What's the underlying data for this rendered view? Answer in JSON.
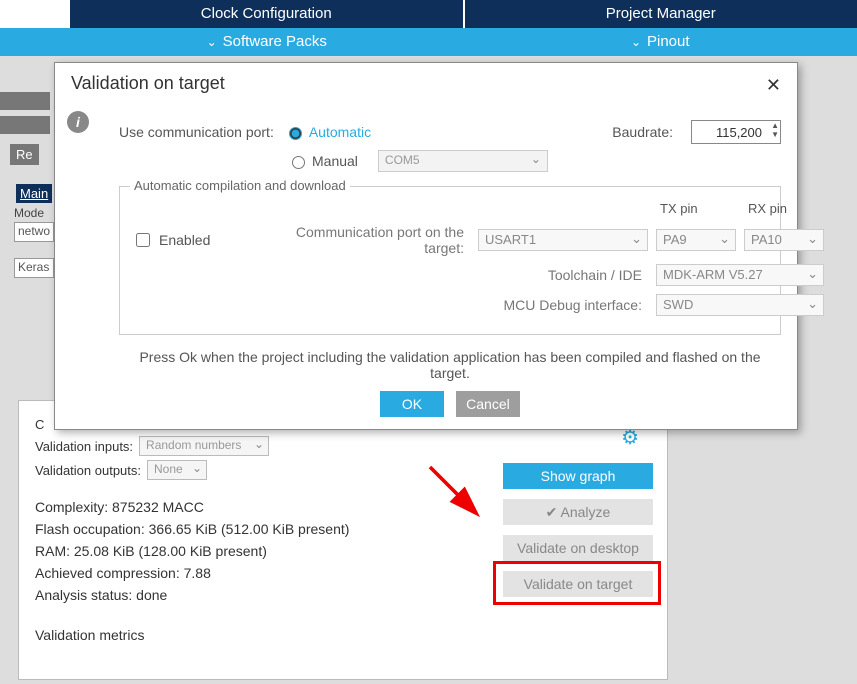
{
  "topTabs": {
    "clock": "Clock Configuration",
    "project": "Project Manager"
  },
  "subTabs": {
    "packs": "Software Packs",
    "pinout": "Pinout"
  },
  "bg": {
    "re": "Re",
    "main": "Main",
    "mode": "Mode",
    "netw": "netwo",
    "keras": "Keras"
  },
  "modal": {
    "title": "Validation on target",
    "commLabel": "Use communication port:",
    "radioAuto": "Automatic",
    "radioManual": "Manual",
    "manualPort": "COM5",
    "baudLabel": "Baudrate:",
    "baudValue": "115,200",
    "fieldsetLegend": "Automatic compilation and download",
    "enabled": "Enabled",
    "commPortTarget": "Communication port on the target:",
    "usart": "USART1",
    "txpinHdr": "TX pin",
    "rxpinHdr": "RX pin",
    "txpin": "PA9",
    "rxpin": "PA10",
    "toolchainLabel": "Toolchain / IDE",
    "toolchain": "MDK-ARM V5.27",
    "mcuLabel": "MCU Debug interface:",
    "mcu": "SWD",
    "hint": "Press Ok when the project including the validation application has been compiled and flashed on the target.",
    "ok": "OK",
    "cancel": "Cancel"
  },
  "lower": {
    "c": "C",
    "valInputsLabel": "Validation inputs:",
    "valInputsValue": "Random numbers",
    "valOutputsLabel": "Validation outputs:",
    "valOutputsValue": "None",
    "complexity": "Complexity:  875232 MACC",
    "flash": "Flash occupation: 366.65 KiB (512.00 KiB present)",
    "ram": "RAM: 25.08 KiB (128.00 KiB present)",
    "compression": "Achieved compression: 7.88",
    "status": "Analysis status: done",
    "metrics": "Validation metrics",
    "btnGraph": "Show graph",
    "btnAnalyze": "Analyze",
    "btnValDesktop": "Validate on desktop",
    "btnValTarget": "Validate on target"
  }
}
